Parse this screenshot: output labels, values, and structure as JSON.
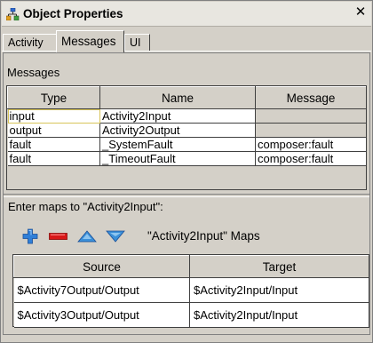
{
  "window": {
    "title": "Object Properties",
    "close_glyph": "✕"
  },
  "tabs": [
    {
      "label": "Activity",
      "active": false
    },
    {
      "label": "Messages",
      "active": true
    },
    {
      "label": "UI",
      "active": false
    }
  ],
  "messages": {
    "section_label": "Messages",
    "columns": [
      "Type",
      "Name",
      "Message"
    ],
    "rows": [
      {
        "type": "input",
        "name": "Activity2Input",
        "message": ""
      },
      {
        "type": "output",
        "name": "Activity2Output",
        "message": ""
      },
      {
        "type": "fault",
        "name": "_SystemFault",
        "message": "composer:fault"
      },
      {
        "type": "fault",
        "name": "_TimeoutFault",
        "message": "composer:fault"
      }
    ]
  },
  "maps": {
    "prompt": "Enter maps to \"Activity2Input\":",
    "toolbar_label": "\"Activity2Input\" Maps",
    "toolbar_icons": [
      "add-icon",
      "remove-icon",
      "move-up-icon",
      "move-down-icon"
    ],
    "columns": [
      "Source",
      "Target"
    ],
    "rows": [
      {
        "source": "$Activity7Output/Output",
        "target": "$Activity2Input/Input"
      },
      {
        "source": "$Activity3Output/Output",
        "target": "$Activity2Input/Input"
      }
    ]
  },
  "colors": {
    "add": "#2f7fd8",
    "remove": "#d81818",
    "arrows": "#3a8fd8",
    "focus_outline": "#d8c55a"
  }
}
